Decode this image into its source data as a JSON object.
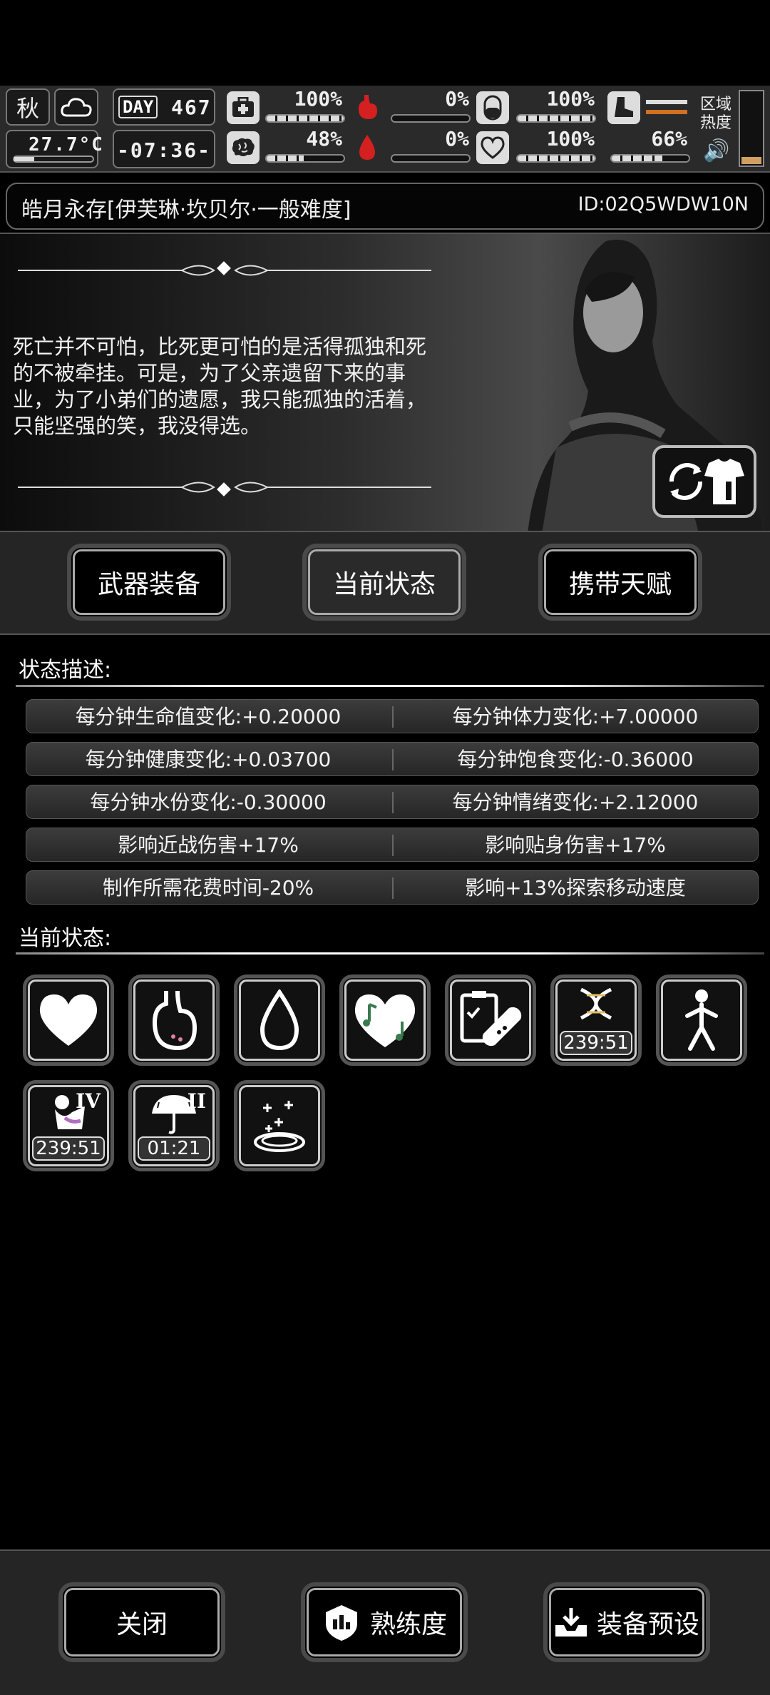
{
  "topbar": {
    "season": "秋",
    "temperature": "27.7°C",
    "day_label": "DAY",
    "day_number": "467",
    "clock": "-07:36-",
    "stats": [
      {
        "icon": "medkit-icon",
        "value": "100%",
        "level": 1.0
      },
      {
        "icon": "stomach-icon",
        "value": "0%",
        "level": 0.0
      },
      {
        "icon": "pill-icon",
        "value": "100%",
        "level": 1.0
      },
      {
        "icon": "brain-icon",
        "value": "48%",
        "level": 0.48
      },
      {
        "icon": "blood-drop-icon",
        "value": "0%",
        "level": 0.0
      },
      {
        "icon": "heart-icon",
        "value": "100%",
        "level": 1.0
      }
    ],
    "stamina": "66%",
    "stamina_level": 0.66,
    "zone_label": "区域热度"
  },
  "title": {
    "text": "皓月永存[伊芙琳·坎贝尔·一般难度]",
    "id": "ID:02Q5WDW10N"
  },
  "portrait": {
    "quote": "死亡并不可怕，比死更可怕的是活得孤独和死的不被牵挂。可是，为了父亲遗留下来的事业，为了小弟们的遗愿，我只能孤独的活着，只能坚强的笑，我没得选。"
  },
  "tabs": [
    {
      "label": "武器装备",
      "active": false
    },
    {
      "label": "当前状态",
      "active": true
    },
    {
      "label": "携带天赋",
      "active": false
    }
  ],
  "status_description": {
    "heading": "状态描述:",
    "rows": [
      [
        "每分钟生命值变化:+0.20000",
        "每分钟体力变化:+7.00000"
      ],
      [
        "每分钟健康变化:+0.03700",
        "每分钟饱食变化:-0.36000"
      ],
      [
        "每分钟水份变化:-0.30000",
        "每分钟情绪变化:+2.12000"
      ],
      [
        "影响近战伤害+17%",
        "影响贴身伤害+17%"
      ],
      [
        "制作所需花费时间-20%",
        "影响+13%探索移动速度"
      ]
    ]
  },
  "current_status": {
    "heading": "当前状态:",
    "icons": [
      {
        "name": "heart-icon",
        "timer": "",
        "roman": ""
      },
      {
        "name": "stomach-icon",
        "timer": "",
        "roman": ""
      },
      {
        "name": "water-drop-icon",
        "timer": "",
        "roman": ""
      },
      {
        "name": "music-heart-icon",
        "timer": "",
        "roman": ""
      },
      {
        "name": "clipboard-pill-icon",
        "timer": "",
        "roman": ""
      },
      {
        "name": "dna-icon",
        "timer": "239:51",
        "roman": ""
      },
      {
        "name": "walking-person-icon",
        "timer": "",
        "roman": ""
      },
      {
        "name": "drinking-icon",
        "timer": "239:51",
        "roman": "IV"
      },
      {
        "name": "umbrella-icon",
        "timer": "01:21",
        "roman": "II"
      },
      {
        "name": "healing-aura-icon",
        "timer": "",
        "roman": ""
      }
    ]
  },
  "bottom": {
    "close": "关闭",
    "proficiency": "熟练度",
    "preset": "装备预设"
  }
}
